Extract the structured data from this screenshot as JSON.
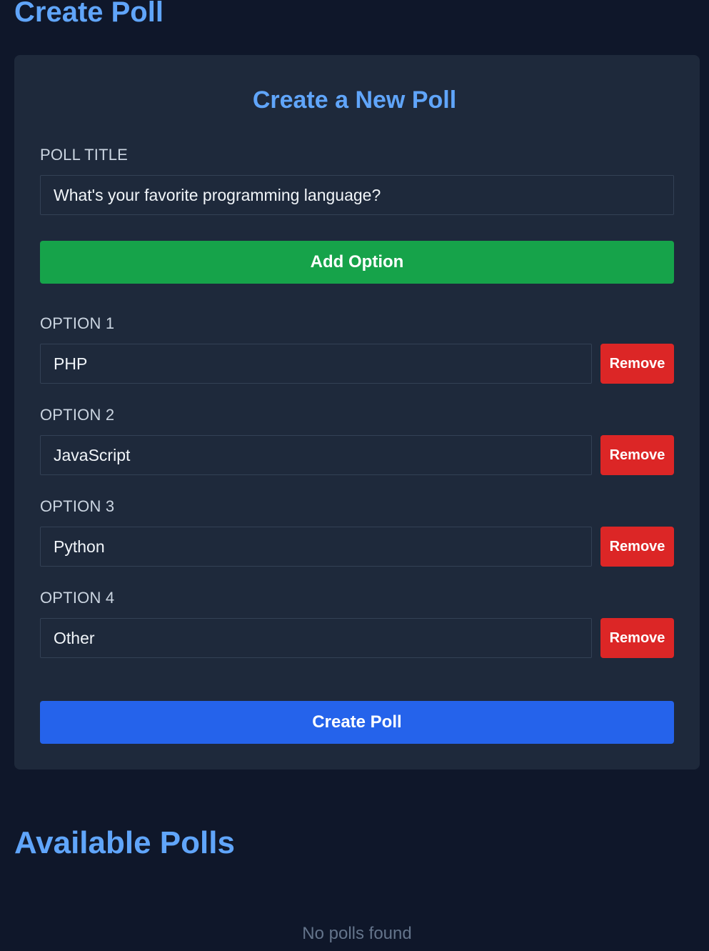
{
  "page": {
    "heading": "Create Poll"
  },
  "form": {
    "title": "Create a New Poll",
    "poll_title_label": "POLL TITLE",
    "poll_title_value": "What's your favorite programming language?",
    "add_option_label": "Add Option",
    "remove_label": "Remove",
    "create_poll_label": "Create Poll",
    "options": [
      {
        "label": "OPTION 1",
        "value": "PHP"
      },
      {
        "label": "OPTION 2",
        "value": "JavaScript"
      },
      {
        "label": "OPTION 3",
        "value": "Python"
      },
      {
        "label": "OPTION 4",
        "value": "Other"
      }
    ]
  },
  "polls": {
    "heading": "Available Polls",
    "empty_message": "No polls found"
  },
  "colors": {
    "background": "#0f172a",
    "card": "#1e293b",
    "accent": "#60a5fa",
    "add_button": "#16a34a",
    "remove_button": "#dc2626",
    "create_button": "#2563eb"
  }
}
